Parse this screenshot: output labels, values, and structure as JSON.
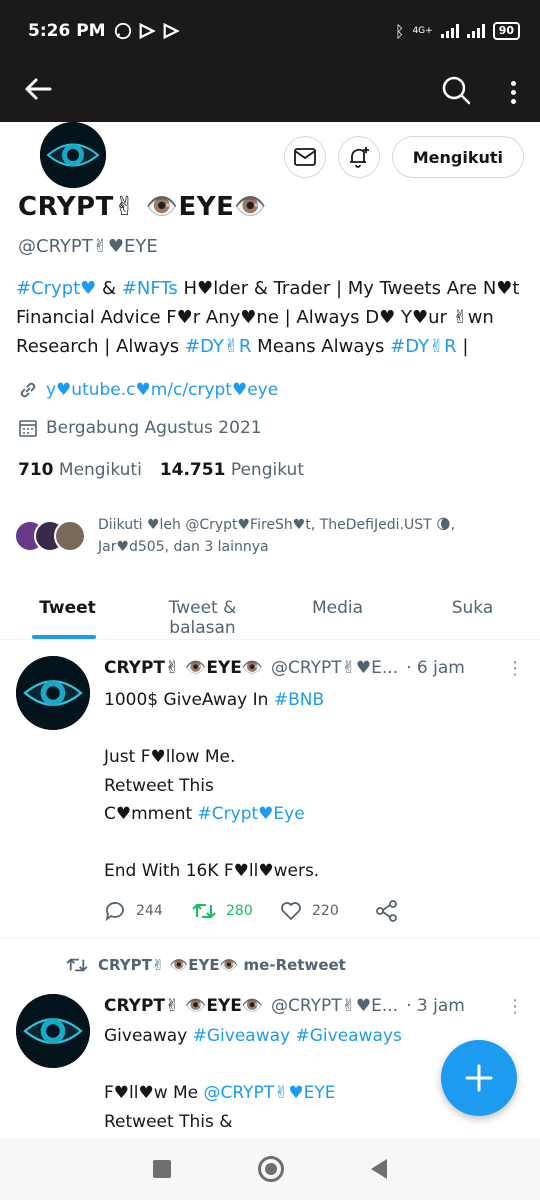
{
  "status_bar": {
    "time": "5:26 PM",
    "network": "4G+",
    "battery": "90"
  },
  "profile": {
    "name": "CRYPT✌ 👁️EYE👁️",
    "handle": "@CRYPT✌♥EYE",
    "bio_parts": [
      {
        "text": "#Crypt♥",
        "link": true
      },
      {
        "text": " & ",
        "link": false
      },
      {
        "text": "#NFTs",
        "link": true
      },
      {
        "text": " H♥lder & Trader | My Tweets Are N♥t Financial Advice F♥r Any♥ne | Always D♥ Y♥ur ✌wn Research | Always ",
        "link": false
      },
      {
        "text": "#DY✌R",
        "link": true
      },
      {
        "text": " Means Always ",
        "link": false
      },
      {
        "text": "#DY✌R",
        "link": true
      },
      {
        "text": " |",
        "link": false
      }
    ],
    "website": "y♥utube.c♥m/c/crypt♥eye",
    "joined": "Bergabung Agustus 2021",
    "following_count": "710",
    "following_label": "Mengikuti",
    "followers_count": "14.751",
    "followers_label": "Pengikut",
    "followed_by": "Diikuti ♥leh @Crypt♥FireSh♥t, TheDefiJedi.UST 🌘, Jar♥d505, dan 3 lainnya",
    "follow_button": "Mengikuti"
  },
  "tabs": [
    {
      "label": "Tweet",
      "active": true
    },
    {
      "label": "Tweet & balasan",
      "active": false
    },
    {
      "label": "Media",
      "active": false
    },
    {
      "label": "Suka",
      "active": false
    }
  ],
  "tweets": [
    {
      "name": "CRYPT✌ 👁️EYE👁️",
      "handle": "@CRYPT✌♥E...",
      "time": "· 6 jam",
      "text_parts": [
        {
          "text": "1000$ GiveAway In ",
          "link": false
        },
        {
          "text": "#BNB",
          "link": true
        },
        {
          "text": "\n\nJust F♥llow Me.\nRetweet This\nC♥mment ",
          "link": false
        },
        {
          "text": "#Crypt♥Eye",
          "link": true
        },
        {
          "text": "\n\nEnd With 16K F♥ll♥wers.",
          "link": false
        }
      ],
      "replies": "244",
      "retweets": "280",
      "likes": "220"
    },
    {
      "retweeted_by": "CRYPT✌ 👁️EYE👁️ me-Retweet",
      "name": "CRYPT✌ 👁️EYE👁️",
      "handle": "@CRYPT✌♥E...",
      "time": "· 3 jam",
      "text_parts": [
        {
          "text": "Giveaway ",
          "link": false
        },
        {
          "text": "#Giveaway",
          "link": true
        },
        {
          "text": " ",
          "link": false
        },
        {
          "text": "#Giveaways",
          "link": true
        },
        {
          "text": "\n\nF♥ll♥w Me ",
          "link": false
        },
        {
          "text": "@CRYPT✌♥EYE",
          "link": true
        },
        {
          "text": "\nRetweet This &",
          "link": false
        }
      ]
    }
  ],
  "colors": {
    "accent": "#1d9bf0",
    "retweet": "#17bf63",
    "topbar": "#1c1a19"
  }
}
